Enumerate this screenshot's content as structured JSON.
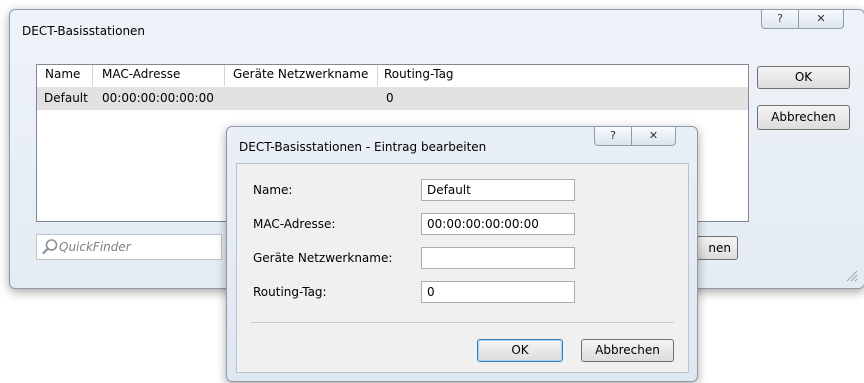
{
  "main_window": {
    "title": "DECT-Basisstationen",
    "help_glyph": "?",
    "close_glyph": "✕",
    "table": {
      "columns": [
        "Name",
        "MAC-Adresse",
        "Geräte Netzwerkname",
        "Routing-Tag"
      ],
      "rows": [
        {
          "name": "Default",
          "mac": "00:00:00:00:00:00",
          "network_name": "",
          "routing_tag": "0"
        }
      ]
    },
    "ok_label": "OK",
    "cancel_label": "Abbrechen",
    "quickfinder_placeholder": "QuickFinder",
    "partial_button_label": "nen"
  },
  "edit_dialog": {
    "title": "DECT-Basisstationen - Eintrag bearbeiten",
    "help_glyph": "?",
    "close_glyph": "✕",
    "fields": {
      "name": {
        "label": "Name:",
        "value": "Default"
      },
      "mac": {
        "label": "MAC-Adresse:",
        "value": "00:00:00:00:00:00"
      },
      "network_name": {
        "label": "Geräte Netzwerkname:",
        "value": ""
      },
      "routing_tag": {
        "label": "Routing-Tag:",
        "value": "0"
      }
    },
    "ok_label": "OK",
    "cancel_label": "Abbrechen"
  }
}
